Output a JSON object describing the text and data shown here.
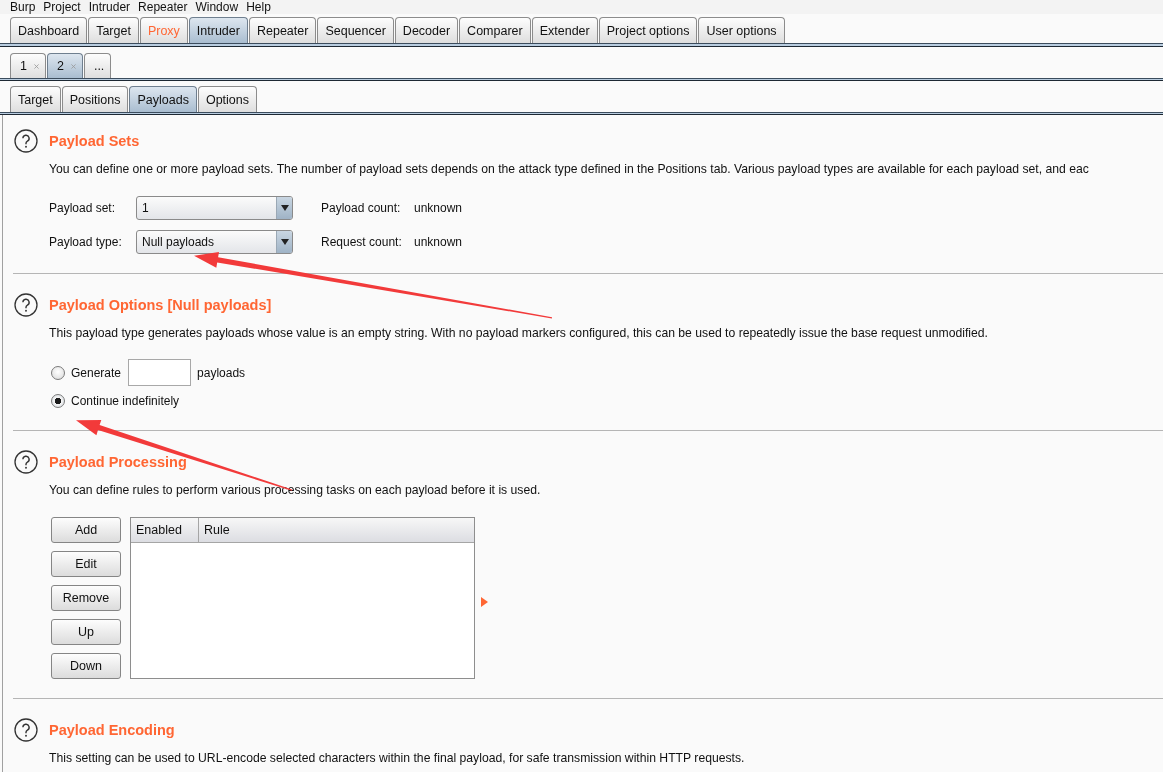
{
  "menu_bar": [
    "Burp",
    "Project",
    "Intruder",
    "Repeater",
    "Window",
    "Help"
  ],
  "main_tabs": [
    {
      "label": "Dashboard",
      "selected": false,
      "highlighted": false
    },
    {
      "label": "Target",
      "selected": false,
      "highlighted": false
    },
    {
      "label": "Proxy",
      "selected": false,
      "highlighted": true
    },
    {
      "label": "Intruder",
      "selected": true,
      "highlighted": false
    },
    {
      "label": "Repeater",
      "selected": false,
      "highlighted": false
    },
    {
      "label": "Sequencer",
      "selected": false,
      "highlighted": false
    },
    {
      "label": "Decoder",
      "selected": false,
      "highlighted": false
    },
    {
      "label": "Comparer",
      "selected": false,
      "highlighted": false
    },
    {
      "label": "Extender",
      "selected": false,
      "highlighted": false
    },
    {
      "label": "Project options",
      "selected": false,
      "highlighted": false
    },
    {
      "label": "User options",
      "selected": false,
      "highlighted": false
    }
  ],
  "attack_tabs": [
    {
      "label": "1",
      "selected": false,
      "closable": true
    },
    {
      "label": "2",
      "selected": true,
      "closable": true
    },
    {
      "label": "...",
      "selected": false,
      "closable": false
    }
  ],
  "sub_tabs": [
    {
      "label": "Target",
      "selected": false
    },
    {
      "label": "Positions",
      "selected": false
    },
    {
      "label": "Payloads",
      "selected": true
    },
    {
      "label": "Options",
      "selected": false
    }
  ],
  "sections": [
    {
      "kind": "payload_sets",
      "title": "Payload Sets",
      "description": "You can define one or more payload sets. The number of payload sets depends on the attack type defined in the Positions tab. Various payload types are available for each payload set, and eac",
      "rows": [
        {
          "label": "Payload set:",
          "value": "1",
          "info_label": "Payload count:",
          "info_value": "unknown"
        },
        {
          "label": "Payload type:",
          "value": "Null payloads",
          "info_label": "Request count:",
          "info_value": "unknown"
        }
      ]
    },
    {
      "kind": "payload_options",
      "title": "Payload Options [Null payloads]",
      "description": "This payload type generates payloads whose value is an empty string. With no payload markers configured, this can be used to repeatedly issue the base request unmodified.",
      "options": [
        {
          "kind": "count",
          "label": "Generate",
          "suffix": "payloads",
          "selected": false
        },
        {
          "kind": "plain",
          "label": "Continue indefinitely",
          "selected": true
        }
      ]
    },
    {
      "kind": "payload_processing",
      "title": "Payload Processing",
      "description": "You can define rules to perform various processing tasks on each payload before it is used.",
      "buttons": [
        "Add",
        "Edit",
        "Remove",
        "Up",
        "Down"
      ],
      "table": {
        "columns": [
          "Enabled",
          "Rule"
        ]
      }
    },
    {
      "kind": "payload_encoding",
      "title": "Payload Encoding",
      "description": "This setting can be used to URL-encode selected characters within the final payload, for safe transmission within HTTP requests."
    }
  ]
}
